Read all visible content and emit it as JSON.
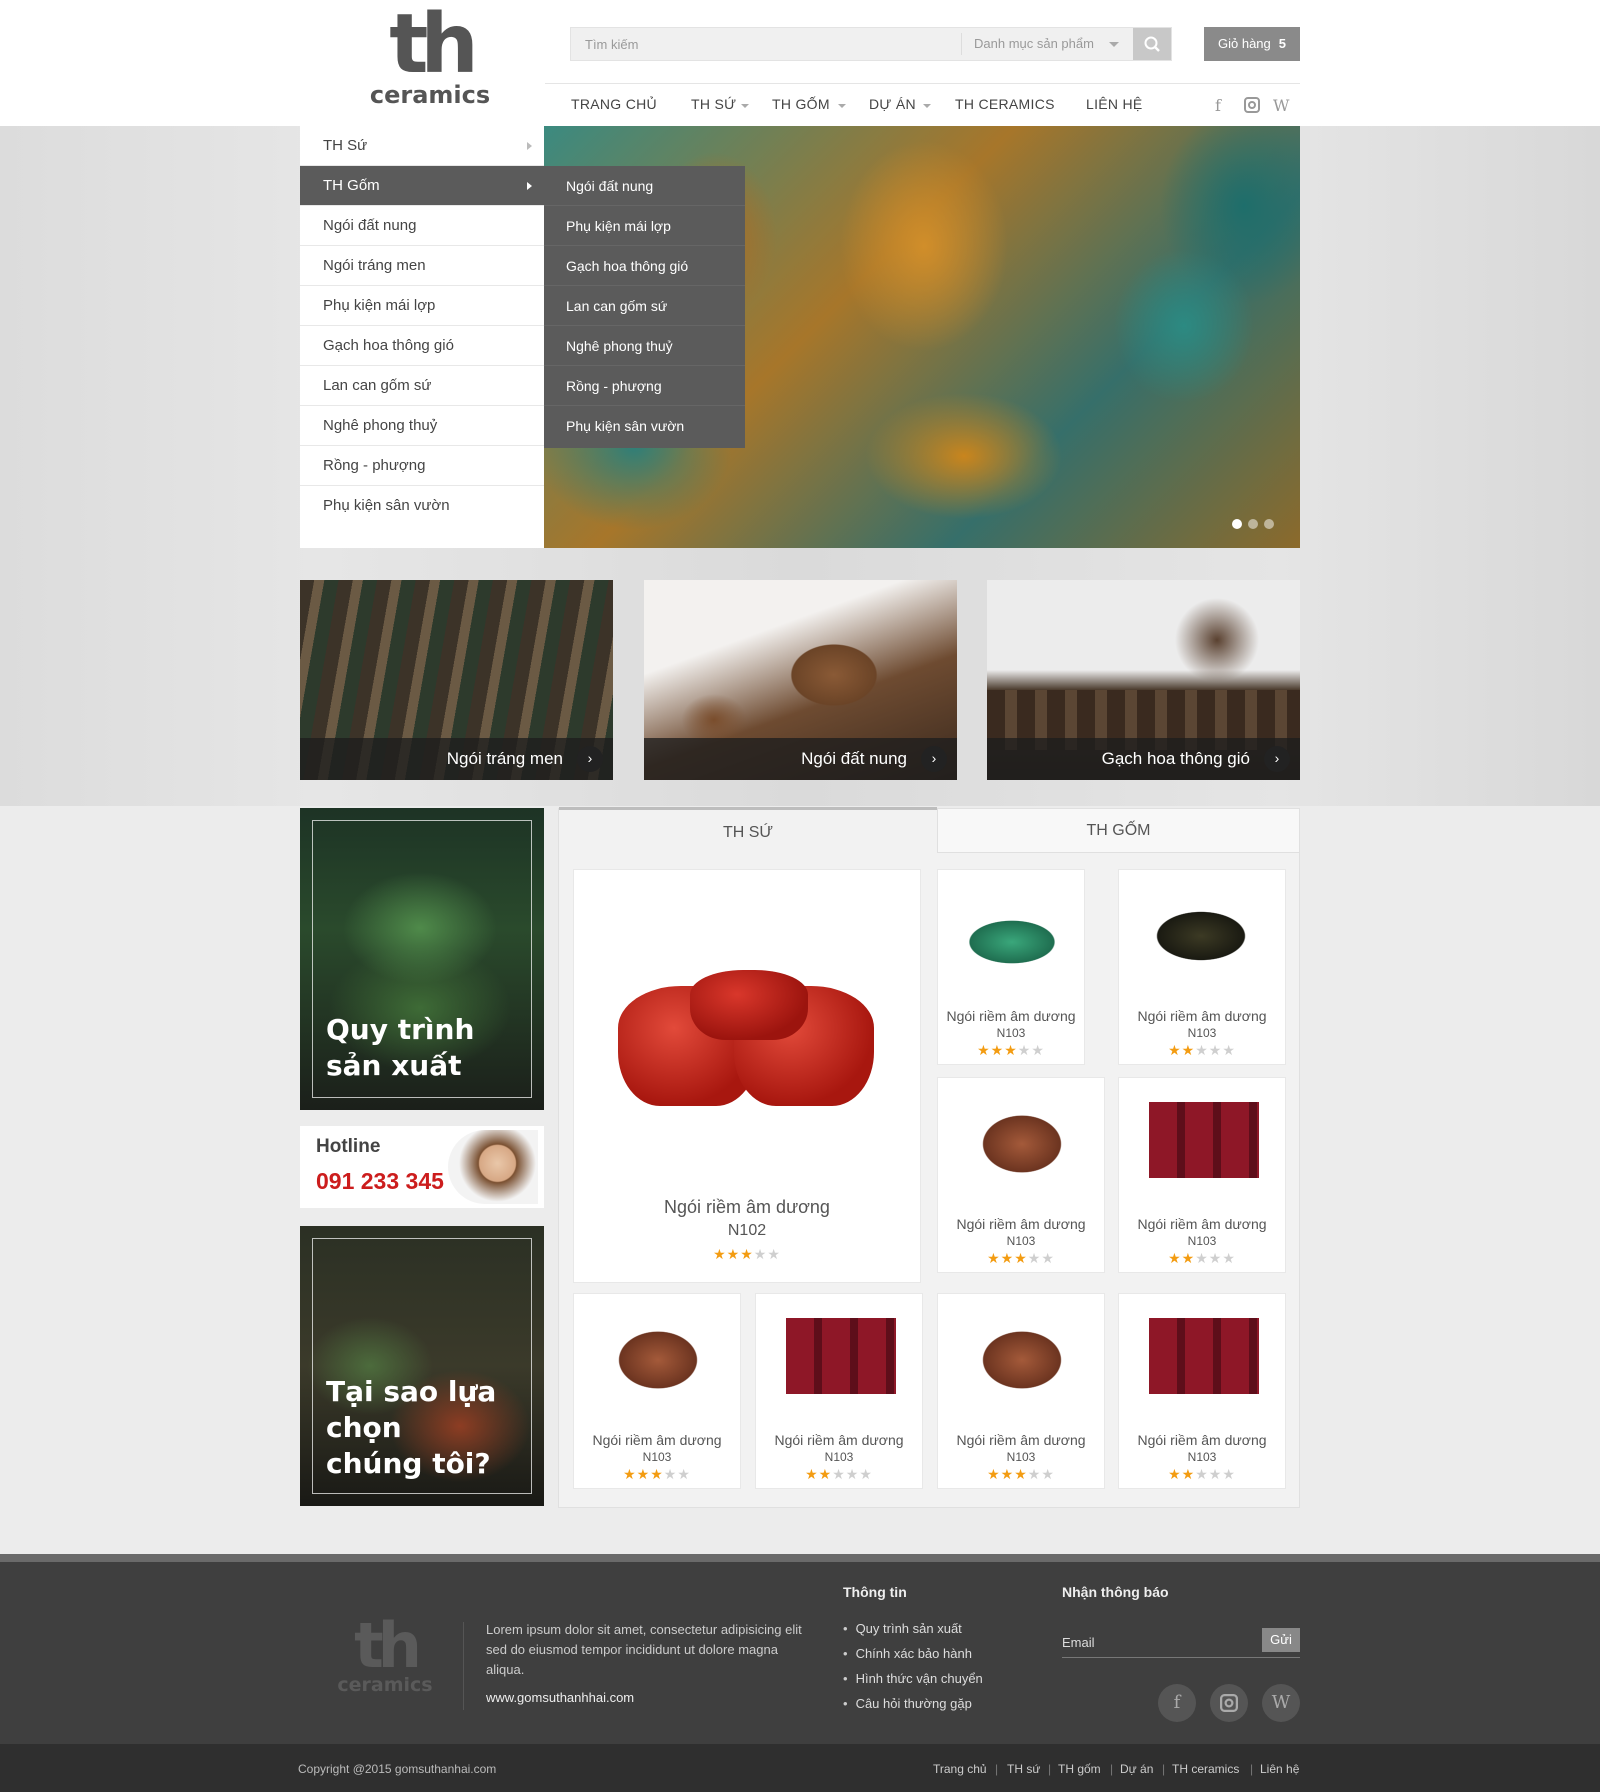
{
  "header": {
    "logo_mark": "th",
    "logo_text": "ceramics",
    "search_placeholder": "Tìm kiếm",
    "category_select": "Danh mục sản phẩm",
    "cart_label": "Giỏ hàng",
    "cart_count": "5"
  },
  "nav": {
    "items": [
      {
        "label": "TRANG CHỦ"
      },
      {
        "label": "TH SỨ"
      },
      {
        "label": "TH GỐM"
      },
      {
        "label": "DỰ ÁN"
      },
      {
        "label": "TH CERAMICS"
      },
      {
        "label": "LIÊN HỆ"
      }
    ],
    "social": [
      "facebook-icon",
      "instagram-icon",
      "wordpress-icon"
    ]
  },
  "category_menu": [
    "TH Sứ",
    "TH Gốm",
    "Ngói đất nung",
    "Ngói tráng men",
    "Phụ kiện mái lợp",
    "Gạch hoa thông gió",
    "Lan can gốm sứ",
    "Nghê phong thuỷ",
    "Rồng - phượng",
    "Phụ kiện sân vườn"
  ],
  "submenu": [
    "Ngói đất nung",
    "Phụ kiện mái lợp",
    "Gạch hoa thông gió",
    "Lan can gốm sứ",
    "Nghê phong thuỷ",
    "Rồng - phượng",
    "Phụ kiện sân vườn"
  ],
  "tiles": [
    {
      "label": "Ngói tráng men"
    },
    {
      "label": "Ngói đất nung"
    },
    {
      "label": "Gạch hoa thông gió"
    }
  ],
  "banners": {
    "process": "Quy trình sản xuất",
    "hotline_label": "Hotline",
    "hotline_number": "091 233 345",
    "why": "Tại sao lựa chọn chúng tôi?"
  },
  "product_tabs": [
    "TH SỨ",
    "TH GỐM"
  ],
  "featured": {
    "name": "Ngói riềm âm dương",
    "code": "N102",
    "rating": 3
  },
  "products": [
    {
      "name": "Ngói riềm âm dương",
      "code": "N103",
      "rating": 3
    },
    {
      "name": "Ngói riềm âm dương",
      "code": "N103",
      "rating": 2
    },
    {
      "name": "Ngói riềm âm dương",
      "code": "N103",
      "rating": 3
    },
    {
      "name": "Ngói riềm âm dương",
      "code": "N103",
      "rating": 2
    },
    {
      "name": "Ngói riềm âm dương",
      "code": "N103",
      "rating": 3
    },
    {
      "name": "Ngói riềm âm dương",
      "code": "N103",
      "rating": 2
    },
    {
      "name": "Ngói riềm âm dương",
      "code": "N103",
      "rating": 3
    },
    {
      "name": "Ngói riềm âm dương",
      "code": "N103",
      "rating": 2
    }
  ],
  "footer": {
    "logo_mark": "th",
    "logo_text": "ceramics",
    "description": "Lorem ipsum dolor sit amet, consectetur adipisicing elit sed do eiusmod tempor incididunt ut dolore magna aliqua.",
    "website": "www.gomsuthanhhai.com",
    "info_title": "Thông tin",
    "info_links": [
      "Quy trình sản xuất",
      "Chính xác bảo hành",
      "Hình thức vận chuyển",
      "Câu hỏi thường gặp"
    ],
    "newsletter_title": "Nhận thông báo",
    "email_placeholder": "Email",
    "send_label": "Gửi",
    "copyright": "Copyright @2015 gomsuthanhai.com",
    "bottom_links": [
      "Trang chủ",
      "TH sứ",
      "TH gốm",
      "Dự án",
      "TH ceramics",
      "Liên hệ"
    ]
  },
  "colors": {
    "accent_dark": "#5b5b5b",
    "hotline_red": "#cc1d1d",
    "star": "#f39c12",
    "footer_bg": "#3f3f3f"
  }
}
